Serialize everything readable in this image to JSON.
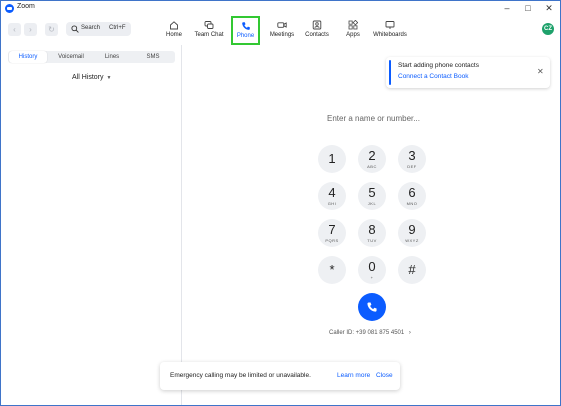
{
  "window": {
    "title": "Zoom"
  },
  "toolbar": {
    "search_label": "Search",
    "search_shortcut": "Ctrl+F",
    "tabs": [
      {
        "label": "Home",
        "icon": "home-icon"
      },
      {
        "label": "Team Chat",
        "icon": "chat-icon"
      },
      {
        "label": "Phone",
        "icon": "phone-icon",
        "active": true
      },
      {
        "label": "Meetings",
        "icon": "video-icon"
      },
      {
        "label": "Contacts",
        "icon": "contacts-icon"
      },
      {
        "label": "Apps",
        "icon": "apps-icon"
      },
      {
        "label": "Whiteboards",
        "icon": "whiteboard-icon"
      }
    ],
    "avatar_initials": "CZ"
  },
  "sidebar": {
    "subtabs": [
      "History",
      "Voicemail",
      "Lines",
      "SMS"
    ],
    "active_subtab": "History",
    "filter_label": "All History"
  },
  "notice": {
    "title": "Start adding phone contacts",
    "link": "Connect a Contact Book"
  },
  "dialer": {
    "placeholder": "Enter a name or number...",
    "keys": [
      {
        "digit": "1",
        "letters": ""
      },
      {
        "digit": "2",
        "letters": "ABC"
      },
      {
        "digit": "3",
        "letters": "DEF"
      },
      {
        "digit": "4",
        "letters": "GHI"
      },
      {
        "digit": "5",
        "letters": "JKL"
      },
      {
        "digit": "6",
        "letters": "MNO"
      },
      {
        "digit": "7",
        "letters": "PQRS"
      },
      {
        "digit": "8",
        "letters": "TUV"
      },
      {
        "digit": "9",
        "letters": "WXYZ"
      },
      {
        "digit": "*",
        "letters": ""
      },
      {
        "digit": "0",
        "letters": "+"
      },
      {
        "digit": "#",
        "letters": ""
      }
    ],
    "caller_id": "Caller ID: +39 081 875 4501"
  },
  "toast": {
    "message": "Emergency calling may be limited or unavailable.",
    "learn_more": "Learn more",
    "close": "Close"
  },
  "colors": {
    "accent": "#0b5cff",
    "highlight": "#32c832"
  }
}
